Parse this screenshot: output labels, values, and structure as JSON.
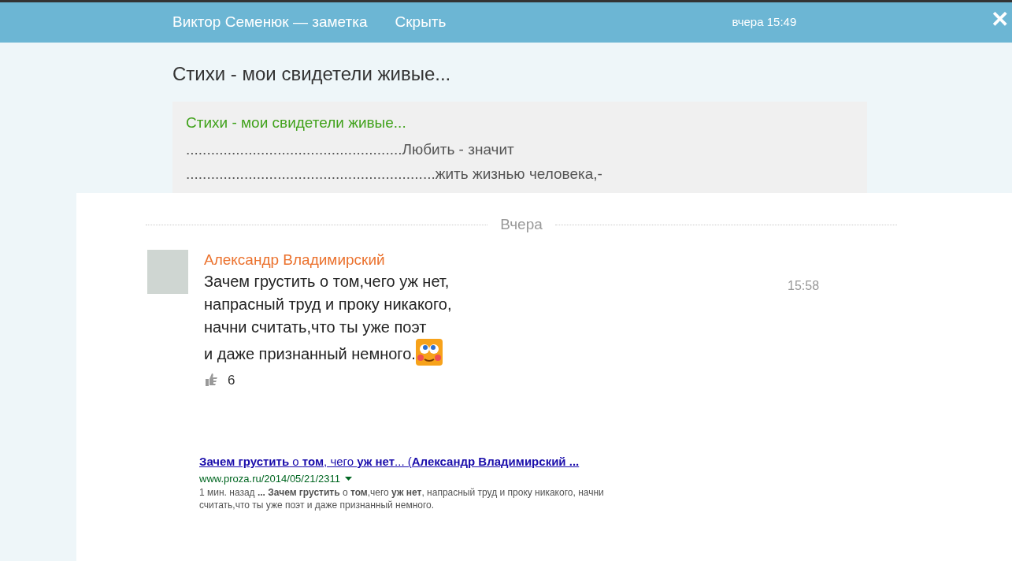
{
  "top_bar": {
    "title": "Виктор Семенюк — заметка",
    "hide_link": "Скрыть",
    "time": "вчера 15:49",
    "close": "✕"
  },
  "note": {
    "heading": "Стихи - мои свидетели живые...",
    "card_title": "Стихи - мои свидетели живые...",
    "lines": [
      "....................................................Любить - значит",
      "............................................................жить жизнью человека,-"
    ]
  },
  "comments": {
    "day_label": "Вчера",
    "items": [
      {
        "author": "Александр Владимирский",
        "time": "15:58",
        "lines": [
          "Зачем грустить о том,чего уж нет,",
          "напрасный труд и проку никакого,",
          "начни считать,что ты уже поэт",
          "и даже признанный немного."
        ],
        "likes": "6"
      }
    ]
  },
  "search_result": {
    "title": "**Зачем грустить** о **том**, чего **уж нет**... (**Александр Владимирский ...**",
    "url": "www.proza.ru/2014/05/21/2311",
    "snippet": "1 мин. назад **... Зачем грустить** о **том**,чего **уж нет**, напрасный труд и проку никакого, начни считать,что ты уже поэт и даже признанный немного."
  }
}
